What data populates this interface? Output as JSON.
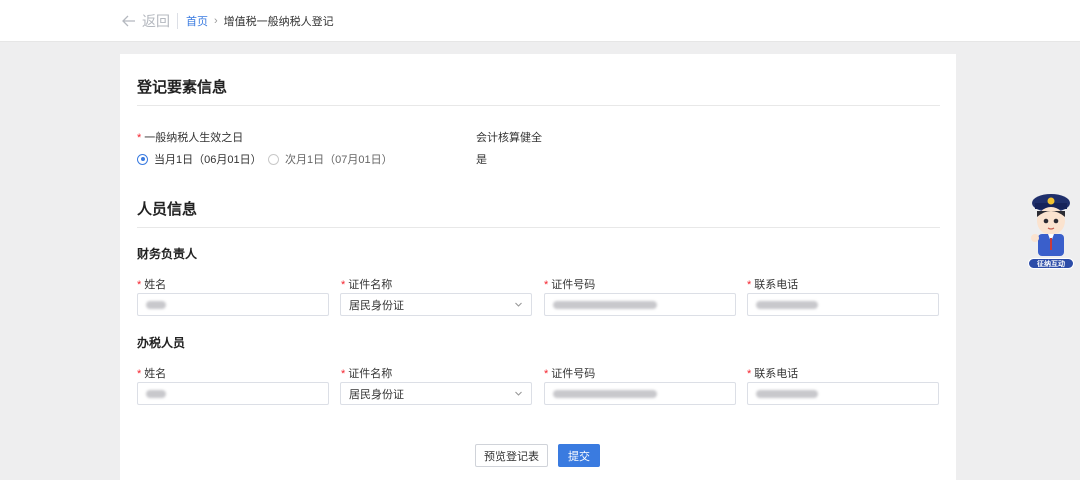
{
  "topbar": {
    "back_label": "返回",
    "breadcrumb": {
      "home": "首页",
      "separator": "›",
      "current": "增值税一般纳税人登记"
    }
  },
  "registration": {
    "title": "登记要素信息",
    "effective_date": {
      "label": "一般纳税人生效之日",
      "options": [
        {
          "label": "当月1日（06月01日）",
          "checked": true
        },
        {
          "label": "次月1日（07月01日）",
          "checked": false
        }
      ]
    },
    "accounting": {
      "label": "会计核算健全",
      "value": "是"
    }
  },
  "personnel": {
    "title": "人员信息",
    "groups": [
      {
        "title": "财务负责人",
        "fields": {
          "name_label": "姓名",
          "id_type_label": "证件名称",
          "id_type_value": "居民身份证",
          "id_number_label": "证件号码",
          "phone_label": "联系电话"
        }
      },
      {
        "title": "办税人员",
        "fields": {
          "name_label": "姓名",
          "id_type_label": "证件名称",
          "id_type_value": "居民身份证",
          "id_number_label": "证件号码",
          "phone_label": "联系电话"
        }
      }
    ]
  },
  "actions": {
    "preview_label": "预览登记表",
    "submit_label": "提交"
  },
  "assistant": {
    "label": "征纳互动",
    "icon": "tax-officer-avatar-icon"
  },
  "colors": {
    "primary": "#3a7be0",
    "required": "#f5222d",
    "background": "#eeeeef"
  }
}
